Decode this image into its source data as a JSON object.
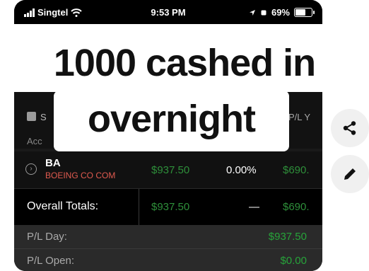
{
  "status_bar": {
    "carrier": "Singtel",
    "time": "9:53 PM",
    "battery": "69%"
  },
  "caption": {
    "line1": "1000 cashed in",
    "line2": "overnight"
  },
  "table": {
    "header_partial_left": "S",
    "header_partial_right": "P/L Y",
    "header_partial_account": "Acc",
    "row": {
      "ticker": "BA",
      "company": "BOEING CO COM",
      "value": "$937.50",
      "change": "0.00%",
      "value_right": "$690."
    },
    "totals": {
      "label": "Overall Totals:",
      "value": "$937.50",
      "change": "—",
      "value_right": "$690."
    },
    "summary": [
      {
        "label": "P/L Day:",
        "value": "$937.50"
      },
      {
        "label": "P/L Open:",
        "value": "$0.00"
      }
    ]
  },
  "actions": {
    "share_icon": "share-icon",
    "edit_icon": "pencil-icon"
  }
}
